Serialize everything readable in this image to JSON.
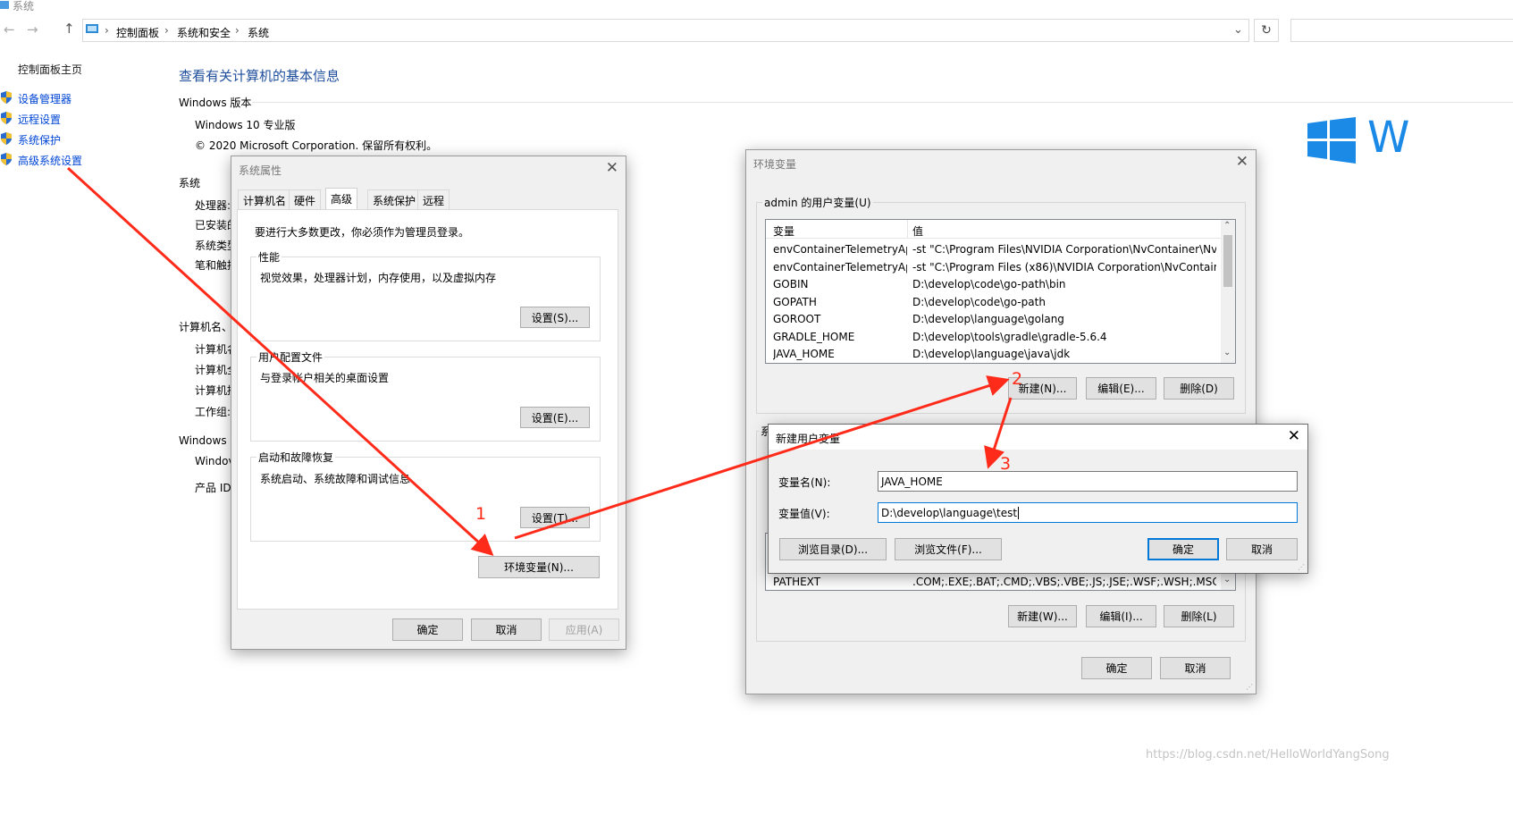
{
  "window": {
    "title": "系统"
  },
  "address": {
    "segments": [
      "控制面板",
      "系统和安全",
      "系统"
    ]
  },
  "sidebar": {
    "home": "控制面板主页",
    "items": [
      {
        "label": "设备管理器",
        "icon": "shield-icon"
      },
      {
        "label": "远程设置",
        "icon": "shield-icon"
      },
      {
        "label": "系统保护",
        "icon": "shield-icon"
      },
      {
        "label": "高级系统设置",
        "icon": "shield-icon"
      }
    ]
  },
  "main": {
    "heading": "查看有关计算机的基本信息",
    "win_edition_header": "Windows 版本",
    "edition": "Windows 10 专业版",
    "copyright": "© 2020 Microsoft Corporation. 保留所有权利。",
    "system_header": "系统",
    "system_labels": [
      "处理器:",
      "已安装的",
      "系统类型",
      "笔和触控"
    ],
    "computer_header": "计算机名、",
    "computer_labels": [
      "计算机名",
      "计算机全",
      "计算机描",
      "工作组:"
    ],
    "activation_header": "Windows 激",
    "activation_labels": [
      "Windov",
      "产品 ID:"
    ],
    "logo_text": "W"
  },
  "sysprops": {
    "title": "系统属性",
    "tabs": [
      "计算机名",
      "硬件",
      "高级",
      "系统保护",
      "远程"
    ],
    "active_tab": 2,
    "admin_note": "要进行大多数更改，你必须作为管理员登录。",
    "perf_title": "性能",
    "perf_desc": "视觉效果，处理器计划，内存使用，以及虚拟内存",
    "perf_btn": "设置(S)...",
    "profile_title": "用户配置文件",
    "profile_desc": "与登录帐户相关的桌面设置",
    "profile_btn": "设置(E)...",
    "startup_title": "启动和故障恢复",
    "startup_desc": "系统启动、系统故障和调试信息",
    "startup_btn": "设置(T)...",
    "env_btn": "环境变量(N)...",
    "ok": "确定",
    "cancel": "取消",
    "apply": "应用(A)"
  },
  "envvars": {
    "title": "环境变量",
    "user_group": "admin 的用户变量(U)",
    "col_var": "变量",
    "col_val": "值",
    "user_rows": [
      {
        "name": "envContainerTelemetryAp...",
        "value": "-st \"C:\\Program Files\\NVIDIA Corporation\\NvContainer\\NvCo..."
      },
      {
        "name": "envContainerTelemetryAp...",
        "value": "-st \"C:\\Program Files (x86)\\NVIDIA Corporation\\NvContainer\\..."
      },
      {
        "name": "GOBIN",
        "value": "D:\\develop\\code\\go-path\\bin"
      },
      {
        "name": "GOPATH",
        "value": "D:\\develop\\code\\go-path"
      },
      {
        "name": "GOROOT",
        "value": "D:\\develop\\language\\golang"
      },
      {
        "name": "GRADLE_HOME",
        "value": "D:\\develop\\tools\\gradle\\gradle-5.6.4"
      },
      {
        "name": "JAVA_HOME",
        "value": "D:\\develop\\language\\java\\jdk"
      }
    ],
    "user_new": "新建(N)...",
    "user_edit": "编辑(E)...",
    "user_delete": "删除(D)",
    "sys_group_partial": "系",
    "sys_visible_row": {
      "name": "PATHEXT",
      "value": ".COM;.EXE;.BAT;.CMD;.VBS;.VBE;.JS;.JSE;.WSF;.WSH;.MSC"
    },
    "sys_new": "新建(W)...",
    "sys_edit": "编辑(I)...",
    "sys_delete": "删除(L)",
    "ok": "确定",
    "cancel": "取消"
  },
  "newvar": {
    "title": "新建用户变量",
    "name_label": "变量名(N):",
    "name_value": "JAVA_HOME",
    "value_label": "变量值(V):",
    "value_value": "D:\\develop\\language\\test",
    "browse_dir": "浏览目录(D)...",
    "browse_file": "浏览文件(F)...",
    "ok": "确定",
    "cancel": "取消"
  },
  "annotations": {
    "n1": "1",
    "n2": "2",
    "n3": "3"
  },
  "watermark": "https://blog.csdn.net/HelloWorldYangSong",
  "colors": {
    "link": "#0046d5",
    "heading": "#1e4e9c",
    "arrow": "#ff2b1a",
    "accent": "#0078d7"
  }
}
